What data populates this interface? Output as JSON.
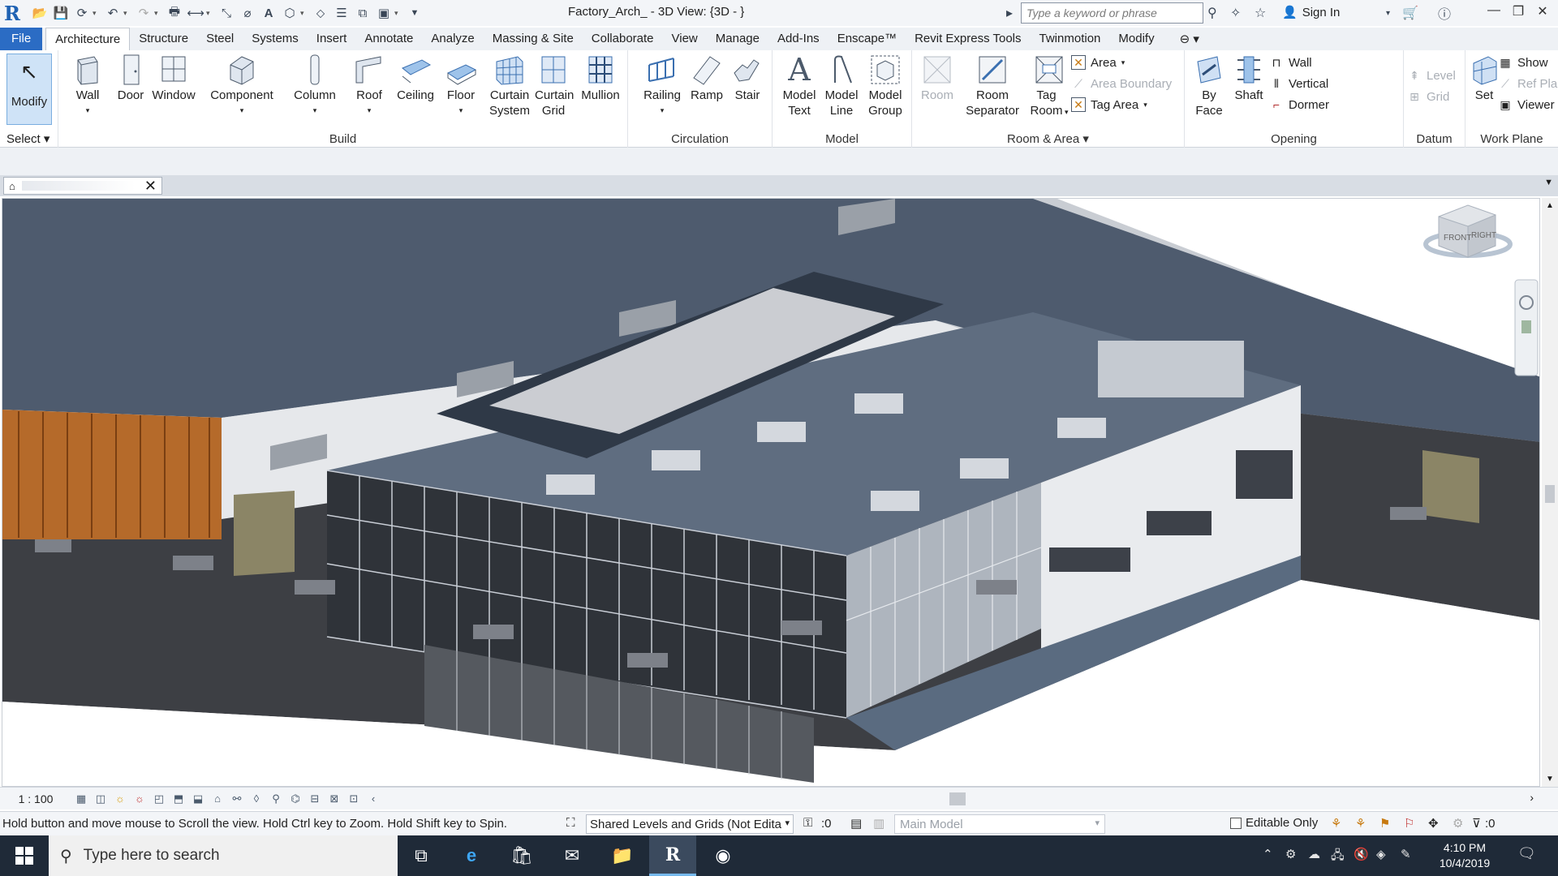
{
  "titlebar": {
    "app_logo": "R",
    "doc_title": "Factory_Arch_        - 3D View: {3D -          }",
    "search_placeholder": "Type a keyword or phrase",
    "signin_label": "Sign In",
    "icons": [
      "binoculars-icon",
      "satellite-icon",
      "star-icon",
      "user-icon",
      "cart-icon",
      "help-icon"
    ]
  },
  "ribbon_tabs": [
    "File",
    "Architecture",
    "Structure",
    "Steel",
    "Systems",
    "Insert",
    "Annotate",
    "Analyze",
    "Massing & Site",
    "Collaborate",
    "View",
    "Manage",
    "Add-Ins",
    "Enscape™",
    "Revit Express Tools",
    "Twinmotion",
    "Modify"
  ],
  "active_tab": "Architecture",
  "ribbon": {
    "select": {
      "modify_label": "Modify",
      "select_label": "Select"
    },
    "build": {
      "title": "Build",
      "tools": [
        "Wall",
        "Door",
        "Window",
        "Component",
        "Column",
        "Roof",
        "Ceiling",
        "Floor",
        "Curtain System",
        "Curtain Grid",
        "Mullion"
      ]
    },
    "circulation": {
      "title": "Circulation",
      "tools": [
        "Railing",
        "Ramp",
        "Stair"
      ]
    },
    "model": {
      "title": "Model",
      "tools": [
        "Model Text",
        "Model Line",
        "Model Group"
      ]
    },
    "room_area": {
      "title": "Room & Area",
      "room": "Room",
      "room_separator": "Room Separator",
      "tag_room": "Tag Room",
      "area": "Area",
      "area_boundary": "Area  Boundary",
      "tag_area": "Tag  Area"
    },
    "opening": {
      "title": "Opening",
      "by_face": "By Face",
      "shaft": "Shaft",
      "wall": "Wall",
      "vertical": "Vertical",
      "dormer": "Dormer"
    },
    "datum": {
      "title": "Datum",
      "level": "Level",
      "grid": "Grid"
    },
    "work_plane": {
      "title": "Work Plane",
      "set": "Set",
      "show": "Show",
      "ref_plane": "Ref  Plane",
      "viewer": "Viewer"
    }
  },
  "view_tab": {
    "label": ""
  },
  "viewcube": {
    "front": "FRONT",
    "right": "RIGHT"
  },
  "viewbar": {
    "scale": "1 : 100"
  },
  "statusbar": {
    "message": "Hold button and move mouse to Scroll the view. Hold Ctrl key to Zoom. Hold Shift key to Spin.",
    "workset": "Shared Levels and Grids (Not Edita",
    "worksets_count": ":0",
    "design_option": "Main Model",
    "editable_only": "Editable Only",
    "filter_count": ":0"
  },
  "taskbar": {
    "search_placeholder": "Type here to search",
    "time": "4:10 PM",
    "date": "10/4/2019"
  }
}
